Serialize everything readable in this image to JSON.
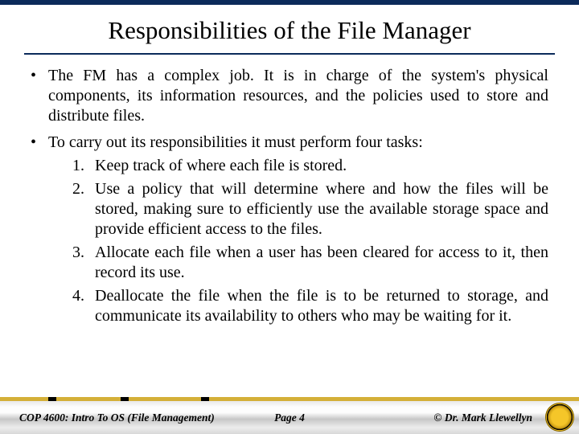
{
  "title": "Responsibilities of the File Manager",
  "bullets": [
    {
      "text": "The FM has a complex job.  It is in charge of the system's physical components, its information resources, and the policies used to store and distribute files."
    },
    {
      "text": "To carry out its responsibilities it must perform four tasks:",
      "numbered": [
        "Keep track of where each file is stored.",
        "Use a policy that will determine where and how the files will be stored, making sure to efficiently use the available storage space and provide efficient access to the files.",
        "Allocate each file when a user has been cleared for access to it, then record its use.",
        "Deallocate the file when the file is to be returned to storage, and communicate its availability to others who may be waiting for it."
      ]
    }
  ],
  "footer": {
    "course": "COP 4600: Intro To OS  (File Management)",
    "page": "Page 4",
    "author": "© Dr. Mark Llewellyn"
  }
}
